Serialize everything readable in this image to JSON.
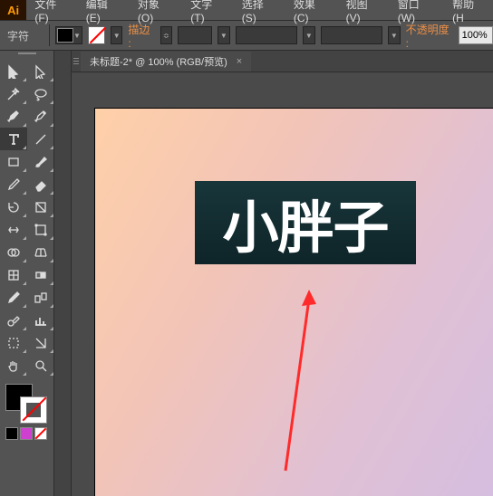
{
  "app_badge": "Ai",
  "menu": [
    "文件(F)",
    "编辑(E)",
    "对象(O)",
    "文字(T)",
    "选择(S)",
    "效果(C)",
    "视图(V)",
    "窗口(W)",
    "帮助(H"
  ],
  "options": {
    "panel": "字符",
    "stroke_label": "描边 :",
    "opacity_label": "不透明度 :",
    "opacity_value": "100%"
  },
  "tab": {
    "title": "未标题-2* @ 100% (RGB/预览)",
    "close": "×"
  },
  "tools": [
    {
      "n": "selection-tool",
      "sel": false
    },
    {
      "n": "direct-selection-tool",
      "sel": false
    },
    {
      "n": "magic-wand-tool",
      "sel": false
    },
    {
      "n": "lasso-tool",
      "sel": false
    },
    {
      "n": "pen-tool",
      "sel": false
    },
    {
      "n": "curvature-tool",
      "sel": false
    },
    {
      "n": "type-tool",
      "sel": true
    },
    {
      "n": "line-segment-tool",
      "sel": false
    },
    {
      "n": "rectangle-tool",
      "sel": false
    },
    {
      "n": "paintbrush-tool",
      "sel": false
    },
    {
      "n": "pencil-tool",
      "sel": false
    },
    {
      "n": "eraser-tool",
      "sel": false
    },
    {
      "n": "rotate-tool",
      "sel": false
    },
    {
      "n": "scale-tool",
      "sel": false
    },
    {
      "n": "width-tool",
      "sel": false
    },
    {
      "n": "free-transform-tool",
      "sel": false
    },
    {
      "n": "shape-builder-tool",
      "sel": false
    },
    {
      "n": "perspective-grid-tool",
      "sel": false
    },
    {
      "n": "mesh-tool",
      "sel": false
    },
    {
      "n": "gradient-tool",
      "sel": false
    },
    {
      "n": "eyedropper-tool",
      "sel": false
    },
    {
      "n": "blend-tool",
      "sel": false
    },
    {
      "n": "symbol-sprayer-tool",
      "sel": false
    },
    {
      "n": "column-graph-tool",
      "sel": false
    },
    {
      "n": "artboard-tool",
      "sel": false
    },
    {
      "n": "slice-tool",
      "sel": false
    },
    {
      "n": "hand-tool",
      "sel": false
    },
    {
      "n": "zoom-tool",
      "sel": false
    }
  ],
  "mini_swatches": [
    "#000000",
    "#d040d0",
    "#ffffff"
  ],
  "canvas_text": "小胖子"
}
